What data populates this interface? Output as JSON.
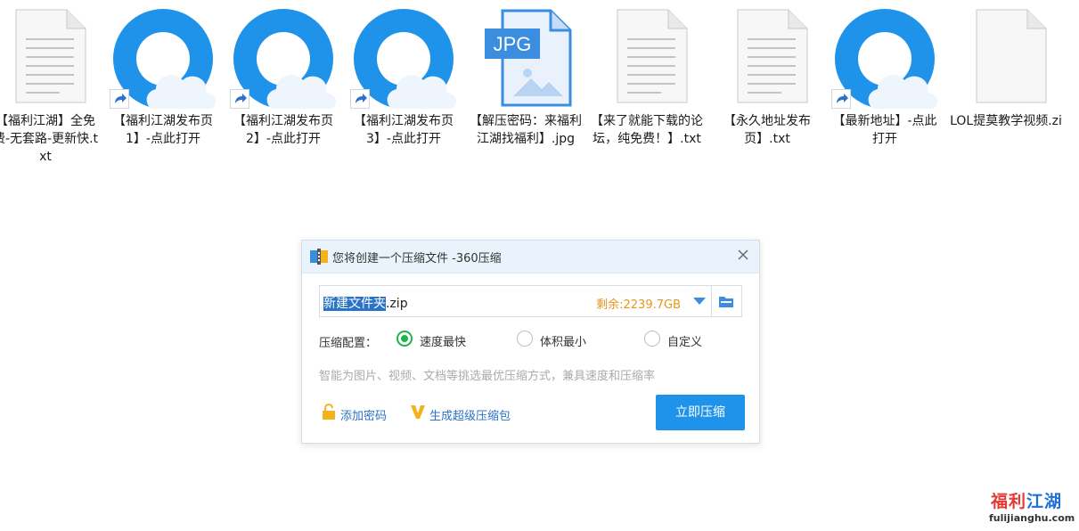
{
  "desktop": {
    "files": [
      {
        "label": "【福利江湖】全免费-无套路-更新快.txt",
        "icon": "text-file-icon"
      },
      {
        "label": "【福利江湖发布页1】-点此打开",
        "icon": "browser-shortcut-icon"
      },
      {
        "label": "【福利江湖发布页2】-点此打开",
        "icon": "browser-shortcut-icon"
      },
      {
        "label": "【福利江湖发布页3】-点此打开",
        "icon": "browser-shortcut-icon"
      },
      {
        "label": "【解压密码：来福利江湖找福利】.jpg",
        "icon": "jpg-file-icon",
        "badge": "JPG"
      },
      {
        "label": "【来了就能下载的论坛，纯免费！】.txt",
        "icon": "text-file-icon"
      },
      {
        "label": "【永久地址发布页】.txt",
        "icon": "text-file-icon"
      },
      {
        "label": "【最新地址】-点此打开",
        "icon": "browser-shortcut-icon"
      },
      {
        "label": "LOL提莫教学视频.zi",
        "icon": "blank-file-icon"
      }
    ]
  },
  "dialog": {
    "title": "您将创建一个压缩文件 -360压缩",
    "filename_selected": "新建文件夹",
    "filename_ext": ".zip",
    "free_space": "剩余:2239.7GB",
    "config_label": "压缩配置：",
    "options": [
      {
        "label": "速度最快",
        "checked": true
      },
      {
        "label": "体积最小",
        "checked": false
      },
      {
        "label": "自定义",
        "checked": false
      }
    ],
    "hint": "智能为图片、视频、文档等挑选最优压缩方式，兼具速度和压缩率",
    "add_password": "添加密码",
    "super_package": "生成超级压缩包",
    "compress_button": "立即压缩"
  },
  "watermark": {
    "logo_text_red": "福利",
    "logo_text_blue": "江湖",
    "domain": "fulijianghu.com"
  },
  "colors": {
    "accent": "#1f93ea",
    "selection": "#2a73c6",
    "free_space": "#e5961d",
    "radio_checked": "#22b24c"
  }
}
